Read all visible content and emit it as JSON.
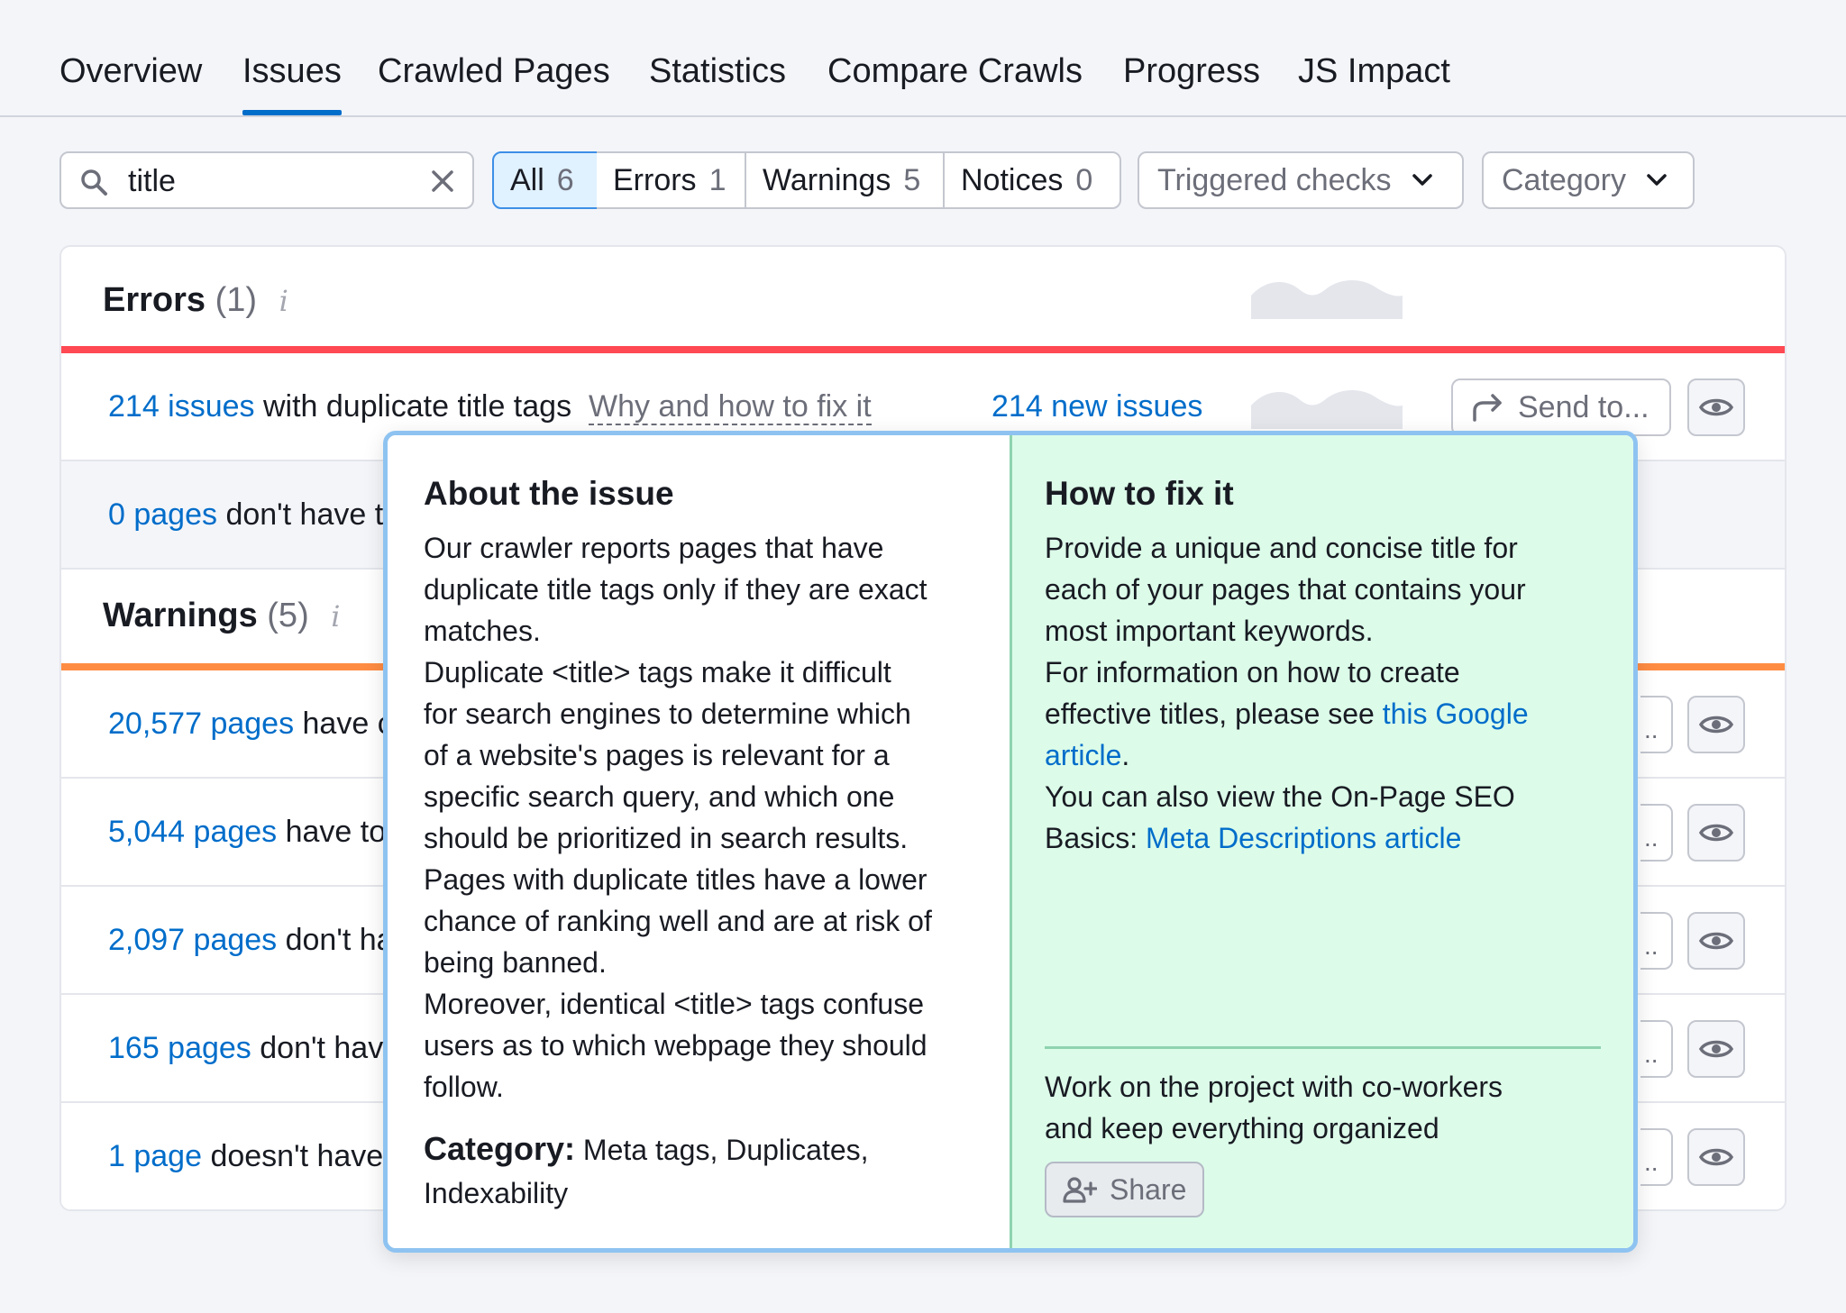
{
  "tabs": [
    {
      "label": "Overview"
    },
    {
      "label": "Issues"
    },
    {
      "label": "Crawled Pages"
    },
    {
      "label": "Statistics"
    },
    {
      "label": "Compare Crawls"
    },
    {
      "label": "Progress"
    },
    {
      "label": "JS Impact"
    }
  ],
  "active_tab": "Issues",
  "search": {
    "value": "title"
  },
  "filters": [
    {
      "label": "All",
      "count": "6"
    },
    {
      "label": "Errors",
      "count": "1"
    },
    {
      "label": "Warnings",
      "count": "5"
    },
    {
      "label": "Notices",
      "count": "0"
    }
  ],
  "active_filter": "All",
  "dropdowns": {
    "triggered": "Triggered checks",
    "category": "Category"
  },
  "errors": {
    "title": "Errors",
    "count": "(1)",
    "info": "i",
    "color": "#ff4953",
    "rows": [
      {
        "link": "214 issues",
        "text": " with duplicate title tags",
        "fix_link": "Why and how to fix it",
        "new_issues": "214 new issues",
        "send_label": "Send to..."
      },
      {
        "link": "0 pages",
        "text": " don't have t"
      }
    ]
  },
  "warnings": {
    "title": "Warnings",
    "count": "(5)",
    "info": "i",
    "color": "#ff8c43",
    "rows": [
      {
        "link": "20,577 pages",
        "text": " have c"
      },
      {
        "link": "5,044 pages",
        "text": " have to"
      },
      {
        "link": "2,097 pages",
        "text": " don't ha"
      },
      {
        "link": "165 pages",
        "text": " don't hav"
      },
      {
        "link": "1 page",
        "text": " doesn't have"
      }
    ]
  },
  "popover": {
    "about": {
      "title": "About the issue",
      "lines": [
        "Our crawler reports pages that have",
        "duplicate title tags only if they are exact",
        "matches.",
        "Duplicate <title> tags make it difficult",
        "for search engines to determine which",
        "of a website's pages is relevant for a",
        "specific search query, and which one",
        "should be prioritized in search results.",
        "Pages with duplicate titles have a lower",
        "chance of ranking well and are at risk of",
        "being banned.",
        "Moreover, identical <title> tags confuse",
        "users as to which webpage they should",
        "follow."
      ],
      "category_label": "Category:",
      "category_value_1": " Meta tags, Duplicates,",
      "category_value_2": "Indexability"
    },
    "fix": {
      "title": "How to fix it",
      "line1": "Provide a unique and concise title for",
      "line2": "each of your pages that contains your",
      "line3": "most important keywords.",
      "line4": "For information on how to create",
      "line5_pre": "effective titles, please see ",
      "line5_link": "this Google",
      "line6_link": "article",
      "line6_post": ".",
      "line7": "You can also view the On-Page SEO",
      "line8_pre": "Basics: ",
      "line8_link": "Meta Descriptions article",
      "collab1": "Work on the project with co-workers",
      "collab2": "and keep everything organized",
      "share_label": "Share"
    }
  },
  "icons": {
    "search": "search-icon",
    "clear": "close-icon",
    "chevron": "chevron-down-icon",
    "share_arrow": "share-arrow-icon",
    "eye": "eye-icon",
    "add_user": "add-user-icon"
  },
  "colors": {
    "accent": "#006dca",
    "error": "#ff4953",
    "warning": "#ff8c43",
    "fix_bg": "#dcfce9"
  }
}
